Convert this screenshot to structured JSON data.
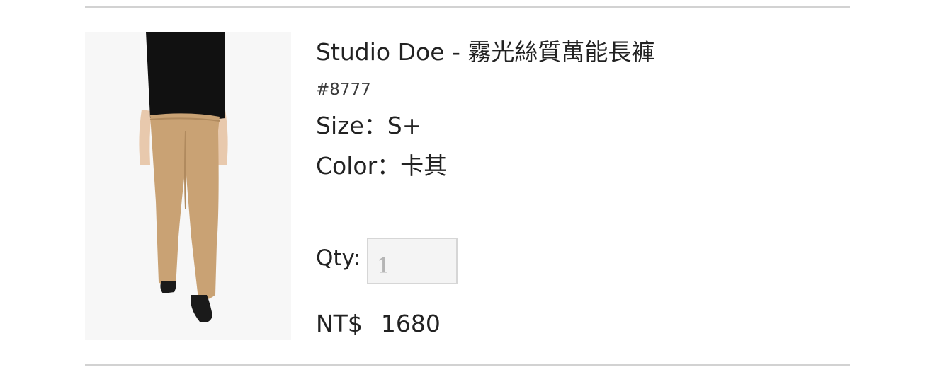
{
  "product": {
    "title": "Studio Doe - 霧光絲質萬能長褲",
    "sku": "#8777",
    "size_label": "Size：",
    "size_value": "S+",
    "color_label": "Color：",
    "color_value": "卡其",
    "qty_label": "Qty:",
    "qty_value": "1",
    "currency": "NT$",
    "price": "1680",
    "image_icon": "product-photo-khaki-pants"
  },
  "colors": {
    "pants": "#c9a274",
    "top": "#111111",
    "divider": "#d2d2d2"
  }
}
